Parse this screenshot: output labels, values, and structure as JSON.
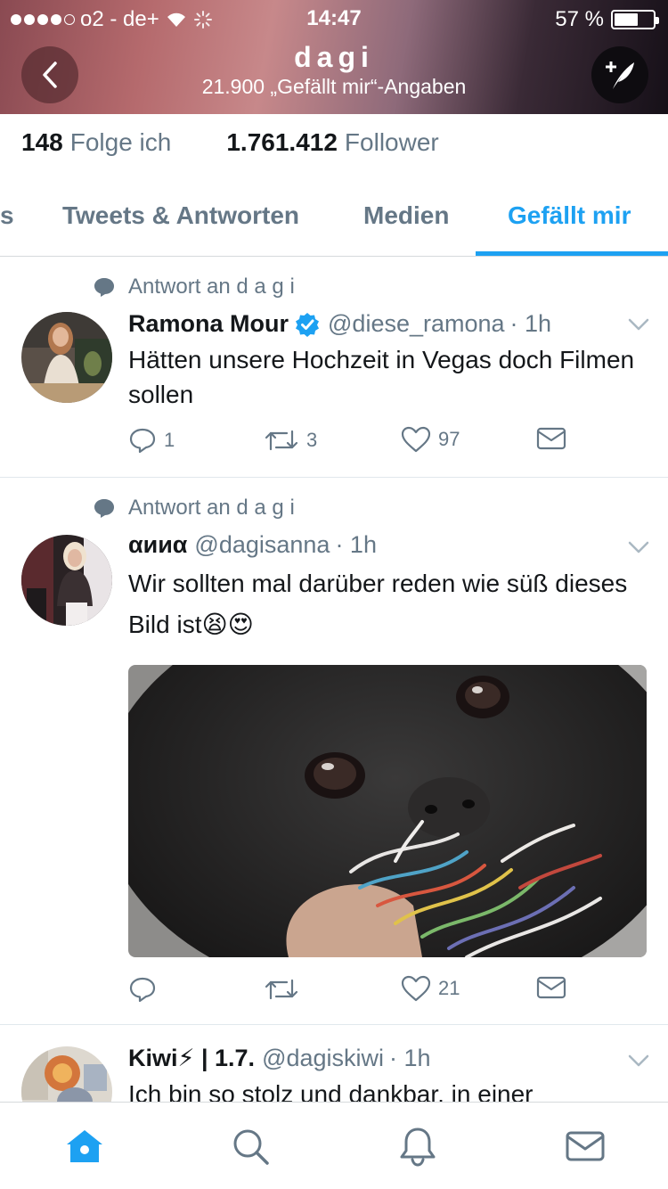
{
  "status_bar": {
    "carrier": "o2 - de+",
    "time": "14:47",
    "battery": "57 %"
  },
  "header": {
    "title": "dagi",
    "subtitle": "21.900 „Gefällt mir“-Angaben"
  },
  "stats": {
    "following_count": "148",
    "following_label": "Folge ich",
    "followers_count": "1.761.412",
    "followers_label": "Follower"
  },
  "tabs": [
    {
      "label": "s"
    },
    {
      "label": "Tweets & Antworten"
    },
    {
      "label": "Medien"
    },
    {
      "label": "Gefällt mir",
      "active": true
    }
  ],
  "tweets": [
    {
      "context": "Antwort an d a g i",
      "name": "Ramona Mour",
      "verified": true,
      "handle": "@diese_ramona",
      "time": "· 1h",
      "text": "Hätten unsere Hochzeit in Vegas doch Filmen sollen",
      "replies": "1",
      "retweets": "3",
      "likes": "97"
    },
    {
      "context": "Antwort an d a g i",
      "name": "αииα",
      "handle": "@dagisanna",
      "time": "· 1h",
      "text": "Wir sollten mal darüber reden wie süß dieses Bild ist😫😍",
      "replies": "",
      "retweets": "",
      "likes": "21"
    },
    {
      "name": "Kiwi⚡ | 1.7.",
      "handle": "@dagiskiwi",
      "time": "· 1h",
      "text": "Ich bin so stolz und dankbar, in einer"
    }
  ],
  "colors": {
    "accent": "#1da1f2",
    "secondary_text": "#657786",
    "primary_text": "#14171a"
  },
  "bottom_nav": [
    {
      "icon": "home-icon",
      "active": true
    },
    {
      "icon": "search-icon"
    },
    {
      "icon": "bell-icon"
    },
    {
      "icon": "mail-icon"
    }
  ]
}
